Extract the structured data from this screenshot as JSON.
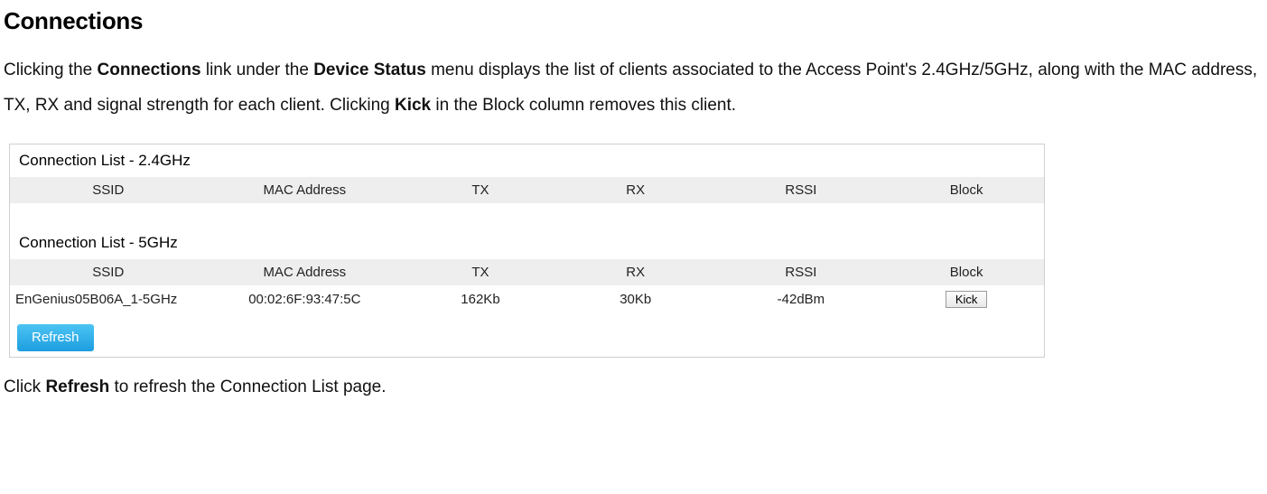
{
  "title": "Connections",
  "description": {
    "pre": "Clicking the ",
    "b1": "Connections",
    "mid1": " link under the ",
    "b2": "Device Status",
    "mid2": " menu displays the list of clients associated to the Access Point's 2.4GHz/5GHz, along with the MAC address, TX, RX and signal strength for each client. Clicking ",
    "b3": "Kick",
    "post": " in the Block column removes this client."
  },
  "sections": {
    "s24": {
      "title": "Connection List - 2.4GHz"
    },
    "s5": {
      "title": "Connection List - 5GHz"
    }
  },
  "columns": {
    "ssid": "SSID",
    "mac": "MAC Address",
    "tx": "TX",
    "rx": "RX",
    "rssi": "RSSI",
    "block": "Block"
  },
  "rows5": [
    {
      "ssid": "EnGenius05B06A_1-5GHz",
      "mac": "00:02:6F:93:47:5C",
      "tx": "162Kb",
      "rx": "30Kb",
      "rssi": "-42dBm",
      "block": "Kick"
    }
  ],
  "refresh_label": "Refresh",
  "footer": {
    "pre": "Click ",
    "b1": "Refresh",
    "post": " to refresh the Connection List page."
  }
}
